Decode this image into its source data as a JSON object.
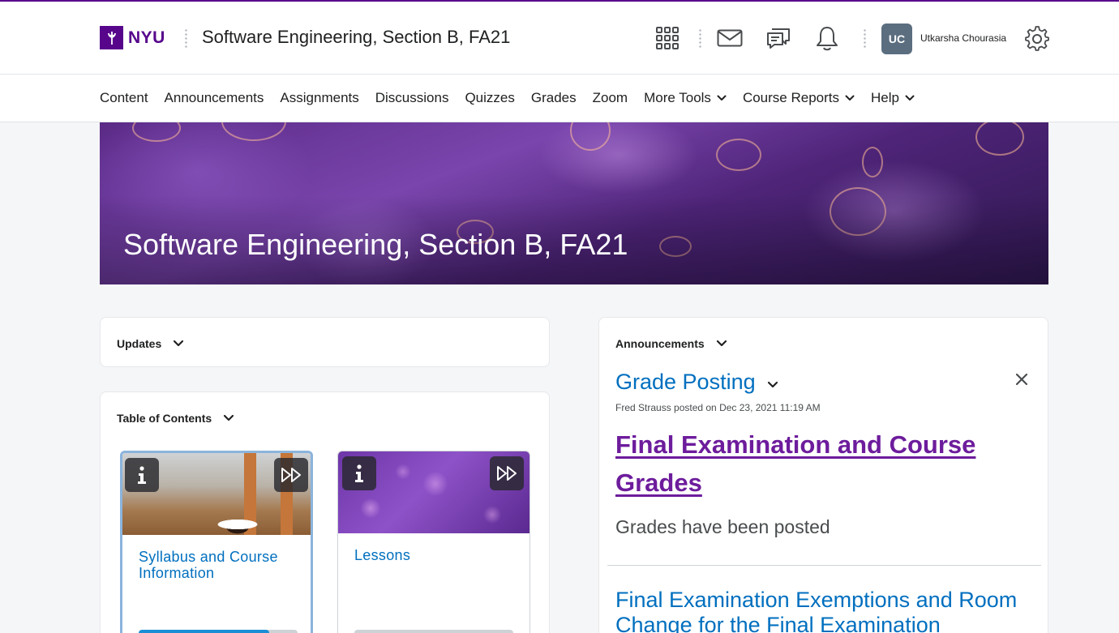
{
  "header": {
    "logo_text": "NYU",
    "course_title": "Software Engineering, Section B, FA21",
    "user": {
      "initials": "UC",
      "name": "Utkarsha Chourasia"
    },
    "icons": [
      "waffle-grid-icon",
      "mail-icon",
      "chat-icon",
      "bell-icon",
      "gear-icon"
    ]
  },
  "nav": {
    "items": [
      {
        "label": "Content",
        "dropdown": false
      },
      {
        "label": "Announcements",
        "dropdown": false
      },
      {
        "label": "Assignments",
        "dropdown": false
      },
      {
        "label": "Discussions",
        "dropdown": false
      },
      {
        "label": "Quizzes",
        "dropdown": false
      },
      {
        "label": "Grades",
        "dropdown": false
      },
      {
        "label": "Zoom",
        "dropdown": false
      },
      {
        "label": "More Tools",
        "dropdown": true
      },
      {
        "label": "Course Reports",
        "dropdown": true
      },
      {
        "label": "Help",
        "dropdown": true
      }
    ]
  },
  "banner": {
    "title": "Software Engineering, Section B, FA21"
  },
  "updates": {
    "heading": "Updates"
  },
  "toc": {
    "heading": "Table of Contents",
    "tiles": [
      {
        "title": "Syllabus and Course Information",
        "progress": 0.82,
        "selected": true
      },
      {
        "title": "Lessons",
        "progress": 0.0,
        "selected": false
      }
    ]
  },
  "announcements": {
    "heading": "Announcements",
    "current": {
      "title": "Grade Posting",
      "meta": "Fred Strauss posted on Dec 23, 2021 11:19 AM",
      "link": "Final Examination and Course Grades",
      "body": "Grades have been posted"
    },
    "next_title": "Final Examination Exemptions and Room Change for the Final Examination"
  },
  "colors": {
    "brand": "#57068c",
    "link": "#006fbf",
    "visited": "#6d1c9c",
    "progress": "#1a8fd6"
  }
}
